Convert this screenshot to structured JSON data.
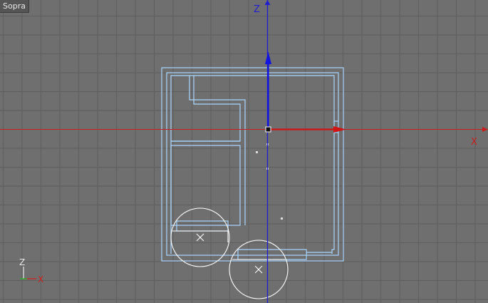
{
  "viewport": {
    "name": "Sopra",
    "background": "#6f6f6f",
    "grid_color": "#5e5e5e",
    "geometry_color": "#a9d6ff",
    "selection_color": "#ffffff"
  },
  "axes": {
    "vertical_label": "Z",
    "horizontal_label": "X",
    "vertical_color": "#1f1fd0",
    "horizontal_color": "#c81e1e"
  },
  "gizmo": {
    "z_label": "Z",
    "x_label": "X",
    "z_color": "#e8e8e8",
    "x_color": "#d02020",
    "y_color": "#20c020"
  }
}
